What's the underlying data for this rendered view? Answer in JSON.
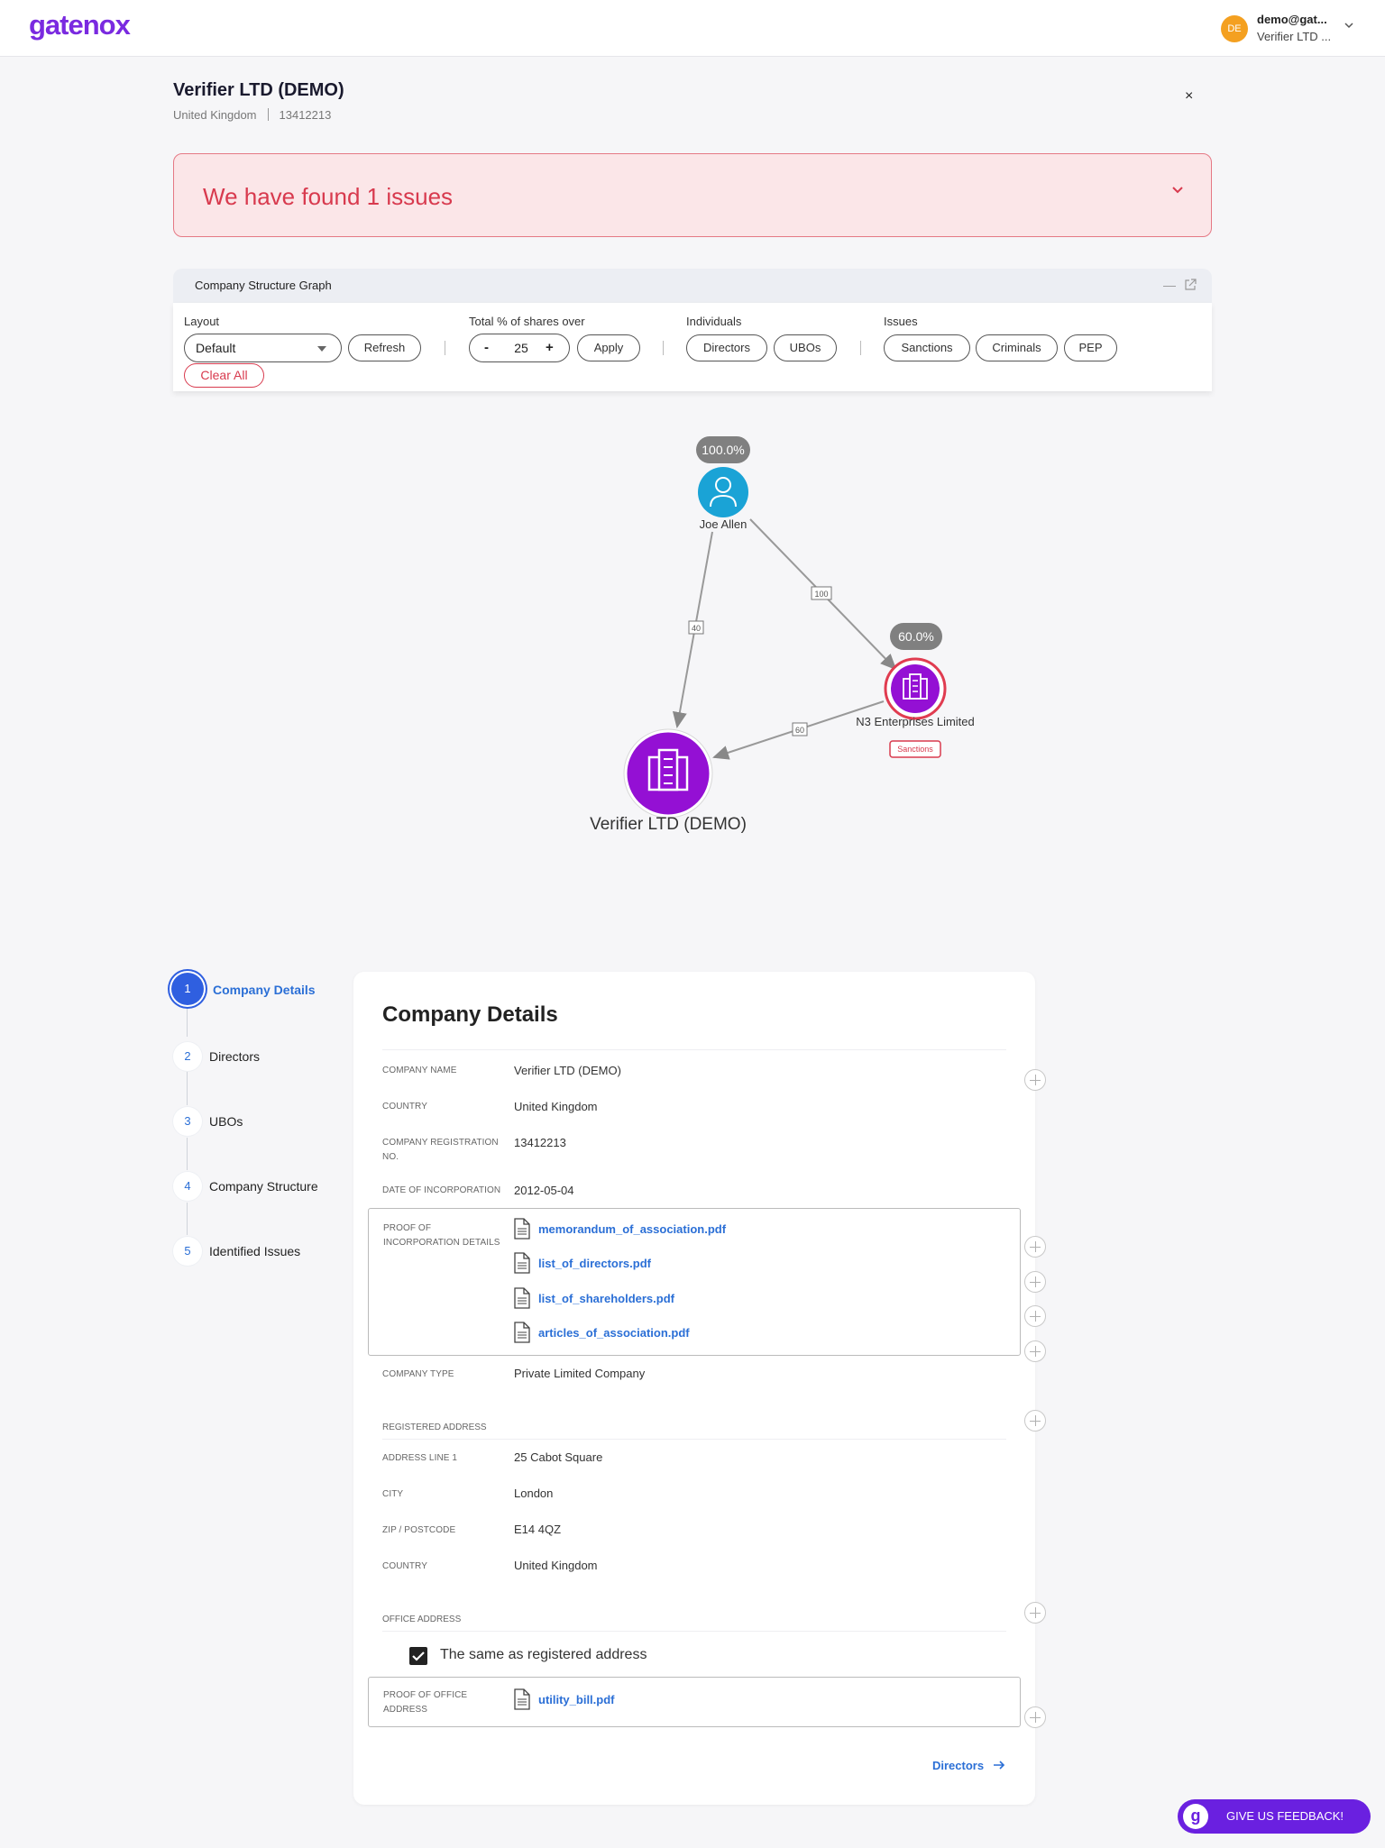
{
  "app": {
    "logo": "gatenox",
    "user_email": "demo@gat...",
    "user_org": "Verifier LTD ...",
    "user_initials": "DE",
    "avatar_color": "#f4a020",
    "accent_color": "#7a2ae0"
  },
  "company": {
    "name": "Verifier LTD (DEMO)",
    "country": "United Kingdom",
    "reg_no": "13412213",
    "close_label": "×"
  },
  "issues_banner": {
    "text": "We have found 1 issues",
    "color": "#d83a4e"
  },
  "graph_panel": {
    "title": "Company Structure Graph",
    "minimize": "—",
    "layout_label": "Layout",
    "layout_value": "Default",
    "refresh_label": "Refresh",
    "shares_label": "Total % of shares over",
    "shares_minus": "-",
    "shares_value": "25",
    "shares_plus": "+",
    "apply_label": "Apply",
    "individuals_label": "Individuals",
    "directors_label": "Directors",
    "ubos_label": "UBOs",
    "issues_label": "Issues",
    "sanctions_label": "Sanctions",
    "criminals_label": "Criminals",
    "pep_label": "PEP",
    "clear_all_label": "Clear All"
  },
  "graph": {
    "nodes": {
      "joe": {
        "label": "Joe Allen",
        "share": "100.0%",
        "type": "person",
        "color": "#1aa3d6"
      },
      "n3": {
        "label": "N3 Enterprises Limited",
        "share": "60.0%",
        "type": "company",
        "color": "#9410d4",
        "badge": "Sanctions"
      },
      "verifier": {
        "label": "Verifier LTD (DEMO)",
        "type": "company",
        "color": "#9410d4"
      }
    },
    "edges": [
      {
        "from": "joe",
        "to": "verifier",
        "label": "40"
      },
      {
        "from": "joe",
        "to": "n3",
        "label": "100"
      },
      {
        "from": "n3",
        "to": "verifier",
        "label": "60"
      }
    ]
  },
  "nav": {
    "steps": [
      {
        "num": "1",
        "label": "Company Details",
        "active": true
      },
      {
        "num": "2",
        "label": "Directors"
      },
      {
        "num": "3",
        "label": "UBOs"
      },
      {
        "num": "4",
        "label": "Company Structure"
      },
      {
        "num": "5",
        "label": "Identified Issues"
      }
    ]
  },
  "details": {
    "title": "Company Details",
    "fields": {
      "company_name": {
        "label": "COMPANY NAME",
        "value": "Verifier LTD (DEMO)"
      },
      "country": {
        "label": "COUNTRY",
        "value": "United Kingdom"
      },
      "reg_no": {
        "label": "COMPANY REGISTRATION NO.",
        "value": "13412213"
      },
      "date_inc": {
        "label": "DATE OF INCORPORATION",
        "value": "2012-05-04"
      },
      "company_type": {
        "label": "COMPANY TYPE",
        "value": "Private Limited Company"
      }
    },
    "proof_inc_label": "PROOF OF INCORPORATION DETAILS",
    "proof_inc_files": [
      "memorandum_of_association.pdf",
      "list_of_directors.pdf",
      "list_of_shareholders.pdf",
      "articles_of_association.pdf"
    ],
    "registered_address": {
      "section_label": "REGISTERED ADDRESS",
      "line1": {
        "label": "ADDRESS LINE 1",
        "value": "25 Cabot Square"
      },
      "city": {
        "label": "CITY",
        "value": "London"
      },
      "zip": {
        "label": "ZIP / POSTCODE",
        "value": "E14 4QZ"
      },
      "country": {
        "label": "COUNTRY",
        "value": "United Kingdom"
      }
    },
    "office_address": {
      "section_label": "OFFICE ADDRESS",
      "same_as_registered": "The same as registered address",
      "checked": true,
      "proof_label": "PROOF OF OFFICE ADDRESS",
      "proof_file": "utility_bill.pdf"
    },
    "next_label": "Directors"
  },
  "feedback": {
    "icon": "g",
    "label": "GIVE US FEEDBACK!",
    "color": "#6a20e0"
  }
}
